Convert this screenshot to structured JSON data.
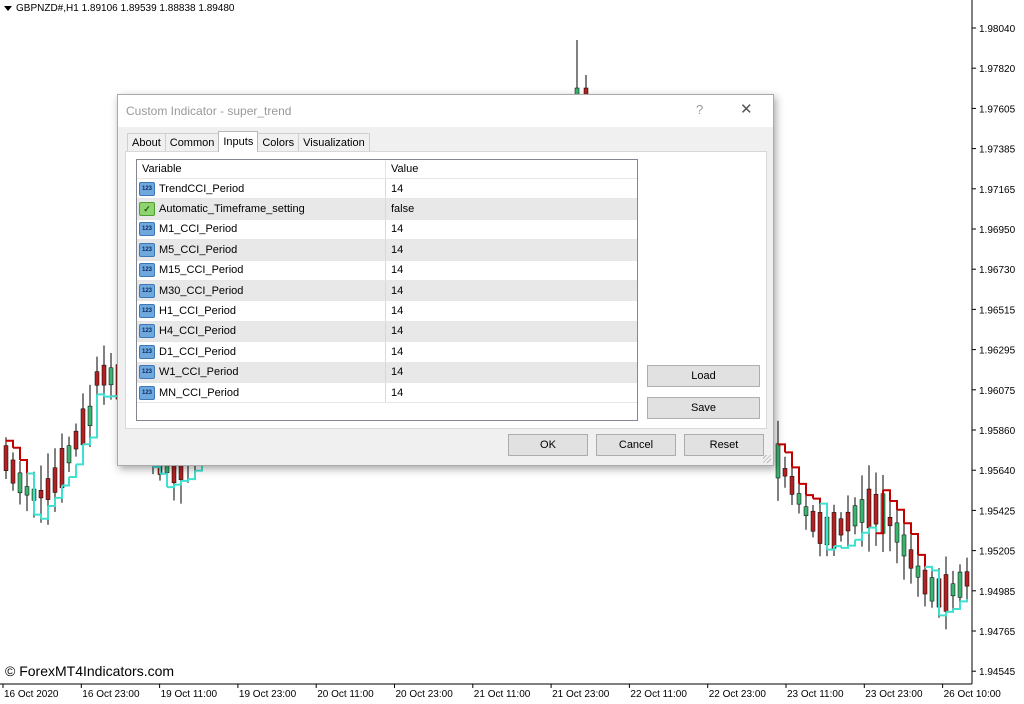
{
  "chart": {
    "symbol_info": "GBPNZD#,H1  1.89106 1.89539 1.88838 1.89480",
    "watermark": "© ForexMT4Indicators.com",
    "price_labels": [
      "1.98040",
      "1.97820",
      "1.97605",
      "1.97385",
      "1.97165",
      "1.96950",
      "1.96730",
      "1.96515",
      "1.96295",
      "1.96075",
      "1.95860",
      "1.95640",
      "1.95425",
      "1.95205",
      "1.94985",
      "1.94765",
      "1.94545"
    ],
    "time_labels": [
      "16 Oct 2020",
      "16 Oct 23:00",
      "19 Oct 11:00",
      "19 Oct 23:00",
      "20 Oct 11:00",
      "20 Oct 23:00",
      "21 Oct 11:00",
      "21 Oct 23:00",
      "22 Oct 11:00",
      "22 Oct 23:00",
      "23 Oct 11:00",
      "23 Oct 23:00",
      "26 Oct 10:00"
    ],
    "colors": {
      "bull": "#3cb371",
      "bear": "#b22222",
      "trend_up": "#40e0d0",
      "trend_down": "#c00000"
    }
  },
  "dialog": {
    "title": "Custom Indicator - super_trend",
    "help_glyph": "?",
    "close_glyph": "✕",
    "tabs": [
      {
        "label": "About"
      },
      {
        "label": "Common"
      },
      {
        "label": "Inputs"
      },
      {
        "label": "Colors"
      },
      {
        "label": "Visualization"
      }
    ],
    "active_tab": "Inputs",
    "grid": {
      "col_variable": "Variable",
      "col_value": "Value",
      "rows": [
        {
          "name": "TrendCCI_Period",
          "value": "14",
          "icon": "int-icon"
        },
        {
          "name": "Automatic_Timeframe_setting",
          "value": "false",
          "icon": "bool-icon"
        },
        {
          "name": "M1_CCI_Period",
          "value": "14",
          "icon": "int-icon"
        },
        {
          "name": "M5_CCI_Period",
          "value": "14",
          "icon": "int-icon"
        },
        {
          "name": "M15_CCI_Period",
          "value": "14",
          "icon": "int-icon"
        },
        {
          "name": "M30_CCI_Period",
          "value": "14",
          "icon": "int-icon"
        },
        {
          "name": "H1_CCI_Period",
          "value": "14",
          "icon": "int-icon"
        },
        {
          "name": "H4_CCI_Period",
          "value": "14",
          "icon": "int-icon"
        },
        {
          "name": "D1_CCI_Period",
          "value": "14",
          "icon": "int-icon"
        },
        {
          "name": "W1_CCI_Period",
          "value": "14",
          "icon": "int-icon"
        },
        {
          "name": "MN_CCI_Period",
          "value": "14",
          "icon": "int-icon"
        }
      ]
    },
    "buttons": {
      "load": "Load",
      "save": "Save",
      "ok": "OK",
      "cancel": "Cancel",
      "reset": "Reset"
    }
  }
}
